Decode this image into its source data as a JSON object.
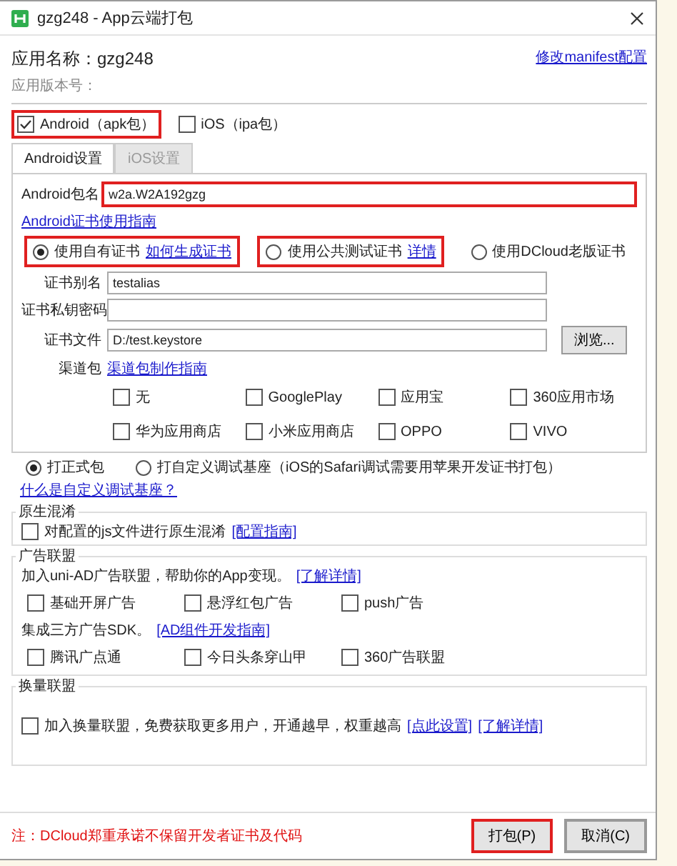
{
  "window": {
    "title": "gzg248 - App云端打包"
  },
  "app_name": "应用名称：gzg248",
  "app_version": "应用版本号：",
  "manifest_link": "修改manifest配置",
  "platforms": [
    {
      "label": "Android（apk包）",
      "checked": true,
      "highlighted": true
    },
    {
      "label": "iOS（ipa包）",
      "checked": false,
      "highlighted": false
    }
  ],
  "tabs": [
    {
      "label": "Android设置",
      "selected": true
    },
    {
      "label": "iOS设置",
      "selected": false
    }
  ],
  "package": {
    "label": "Android包名",
    "value": "w2a.W2A192gzg",
    "highlighted": true
  },
  "cert_guide_link": "Android证书使用指南",
  "cert_options": [
    {
      "label": "使用自有证书",
      "link": "如何生成证书",
      "selected": true,
      "highlighted": true
    },
    {
      "label": "使用公共测试证书",
      "link": "详情",
      "selected": false,
      "highlighted": true
    },
    {
      "label": "使用DCloud老版证书",
      "selected": false,
      "highlighted": false
    }
  ],
  "cert_fields": [
    {
      "label": "证书别名",
      "value": "testalias"
    },
    {
      "label": "证书私钥密码"
    },
    {
      "label": "证书文件",
      "value": "D:/test.keystore",
      "button": "浏览..."
    }
  ],
  "channels": {
    "label": "渠道包",
    "link": "渠道包制作指南",
    "options": [
      {
        "label": "无",
        "checked": false
      },
      {
        "label": "GooglePlay",
        "checked": false
      },
      {
        "label": "应用宝",
        "checked": false
      },
      {
        "label": "360应用市场",
        "checked": false
      },
      {
        "label": "华为应用商店",
        "checked": false
      },
      {
        "label": "小米应用商店",
        "checked": false
      },
      {
        "label": "OPPO",
        "checked": false
      },
      {
        "label": "VIVO",
        "checked": false
      }
    ]
  },
  "build_types": [
    {
      "label": "打正式包",
      "selected": true
    },
    {
      "label": "打自定义调试基座（iOS的Safari调试需要用苹果开发证书打包）",
      "selected": false
    }
  ],
  "build_link": "什么是自定义调试基座？",
  "obfuscation": {
    "title": "原生混淆",
    "label": "对配置的js文件进行原生混淆",
    "checked": false,
    "link": "[配置指南]"
  },
  "ads": {
    "title": "广告联盟",
    "intro": "加入uni-AD广告联盟，帮助你的App变现。",
    "intro_link": "[了解详情]",
    "options": [
      {
        "label": "基础开屏广告",
        "checked": false
      },
      {
        "label": "悬浮红包广告",
        "checked": false
      },
      {
        "label": "push广告",
        "checked": false
      }
    ],
    "sdk_intro": "集成三方广告SDK。",
    "sdk_link": "[AD组件开发指南]",
    "sdk_options": [
      {
        "label": "腾讯广点通",
        "checked": false
      },
      {
        "label": "今日头条穿山甲",
        "checked": false
      },
      {
        "label": "360广告联盟",
        "checked": false
      }
    ]
  },
  "exchange": {
    "title": "换量联盟",
    "label": "加入换量联盟，免费获取更多用户，开通越早，权重越高",
    "checked": false,
    "links": [
      "[点此设置]",
      "[了解详情]"
    ]
  },
  "footer": {
    "note": "注：DCloud郑重承诺不保留开发者证书及代码",
    "buttons": [
      {
        "label": "打包(P)",
        "highlighted": true
      },
      {
        "label": "取消(C)",
        "highlighted": false
      }
    ]
  }
}
